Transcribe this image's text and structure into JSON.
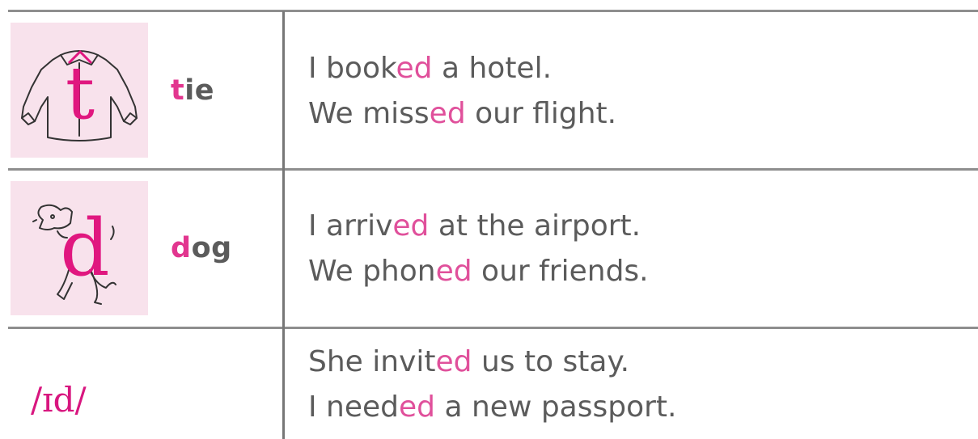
{
  "rows": [
    {
      "icon": "shirt-t-icon",
      "word": {
        "first": "t",
        "rest": "ie"
      },
      "sentences": [
        {
          "before": "I book",
          "ending": "ed",
          "after": " a hotel."
        },
        {
          "before": "We miss",
          "ending": "ed",
          "after": " our flight."
        }
      ]
    },
    {
      "icon": "dog-d-icon",
      "word": {
        "first": "d",
        "rest": "og"
      },
      "sentences": [
        {
          "before": "I arriv",
          "ending": "ed",
          "after": " at the airport."
        },
        {
          "before": "We phon",
          "ending": "ed",
          "after": " our friends."
        }
      ]
    },
    {
      "ipa": "/ɪd/",
      "sentences": [
        {
          "before": "She invit",
          "ending": "ed",
          "after": " us to stay."
        },
        {
          "before": "I need",
          "ending": "ed",
          "after": " a new passport."
        }
      ]
    }
  ],
  "colors": {
    "accent": "#e2368f",
    "icon_bg": "#f8e2ec",
    "text": "#5b5b5b",
    "rule": "#8e8e8e"
  }
}
